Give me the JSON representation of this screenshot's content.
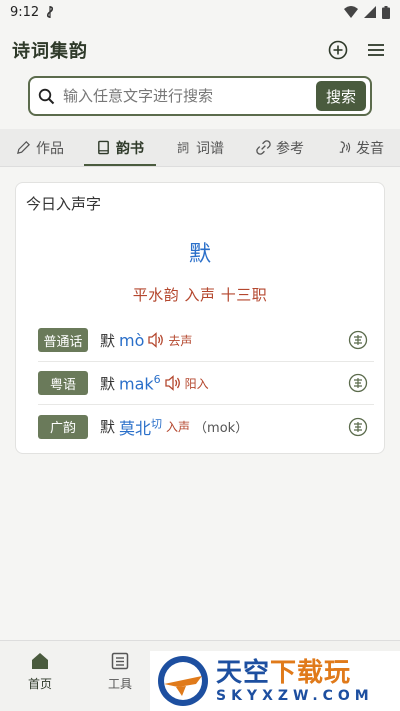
{
  "status": {
    "time": "9:12"
  },
  "header": {
    "title": "诗词集韵"
  },
  "search": {
    "placeholder": "输入任意文字进行搜索",
    "button": "搜索"
  },
  "tabs": [
    {
      "label": "作品",
      "icon": "pencil-icon"
    },
    {
      "label": "韵书",
      "icon": "book-icon",
      "active": true
    },
    {
      "label": "词谱",
      "icon": "ci-icon"
    },
    {
      "label": "参考",
      "icon": "link-icon"
    },
    {
      "label": "发音",
      "icon": "speak-icon"
    }
  ],
  "card": {
    "title": "今日入声字",
    "char": "默",
    "rhyme": "平水韵 入声 十三职",
    "rows": [
      {
        "badge": "普通话",
        "char": "默",
        "pron": "mò",
        "sup": "",
        "tone": "去声",
        "extra": ""
      },
      {
        "badge": "粤语",
        "char": "默",
        "pron": "mak",
        "sup": "6",
        "tone": "阳入",
        "extra": ""
      },
      {
        "badge": "广韵",
        "char": "默",
        "pron": "莫北",
        "sup": "切",
        "tone": "入声",
        "extra": "（mok）"
      }
    ]
  },
  "bottom_nav": [
    {
      "label": "首页",
      "icon": "home-icon",
      "active": true
    },
    {
      "label": "工具",
      "icon": "tools-icon"
    }
  ],
  "watermark": {
    "main_a": "天空",
    "main_b": "下载玩",
    "sub": "SKYXZW.COM"
  },
  "colors": {
    "accent": "#4a5b3e",
    "link": "#2a6fc9",
    "tone": "#b4472e"
  }
}
